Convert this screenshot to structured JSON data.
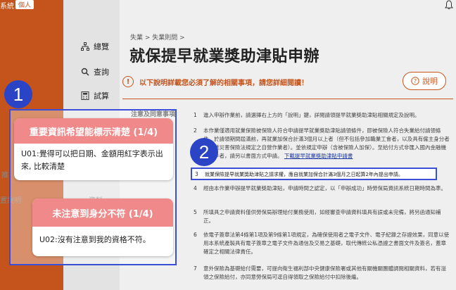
{
  "appbar": {
    "system_label": "系統",
    "tag": "個人"
  },
  "sidebar": {
    "items": [
      {
        "label": "總覽",
        "icon": "sitemap-icon"
      },
      {
        "label": "查詢",
        "icon": "search-icon"
      },
      {
        "label": "試算",
        "icon": "calculator-icon"
      }
    ],
    "faded_label_1": "推",
    "faded_label_2": "置說明",
    "faded_label_3": "資料"
  },
  "main": {
    "breadcrumb": "失業 > 失業則問 >",
    "title": "就保提早就業獎助津貼申辦",
    "notice": "以下說明詳載您必須了解的相關事項，請您詳細閱讀！",
    "explain_button": "說明",
    "left_heading": "注意及同意事項",
    "rules": [
      {
        "num": "1",
        "text": "進入申辦作業前，請選擇右上方的「說明」鍵，詳閱請領提早就業獎助津貼相關規定及說明。"
      },
      {
        "num": "2",
        "text": "本作業僅適用就業保險被保險人符合申請提早就業獎助津貼請領條件，即被保險人符合失業給付請領條件，於請領期間屆滿前，再就業加保合計滿3個月以上者（但不包括參加職業工會者，以及具有僱主身分者及職業災害保險法規定之自營作業者）。並依規定申辦（含被保險人加保）。至給付方式非匯入國內金融機構帳戶者，請另以書面方式申請。",
        "link": "下載提早就業獎助津貼申請書"
      },
      {
        "num": "3",
        "text": "就業保險提早就業獎助津貼之請求權，應自就業加保合計滿3個月之日起算2年內提出申請。"
      },
      {
        "num": "4",
        "text": "經由本作業申辦提早就業獎助津貼，申請時間之認定，以「申辦成功」時勞保局資訊系統日期時間為準。"
      },
      {
        "num": "5",
        "text": "所填具之申請資料僅供勞保局辦理給付業務使用，如經審查申請資料填具有誤或未完備，將另函通知補正。"
      },
      {
        "num": "6",
        "text": "依電子簽章法第4條第1項及第9條第1項規定，為確保使用者之電子文件、電子紀錄之存證效果，同意以使用本系統產製具有電子簽章之電子文件為通信及交易之基礎，取代傳統公私憑證之書面文件及簽名，蓋章確定之相關法律責任。"
      },
      {
        "num": "7",
        "text": "意外保險為基礎給付需要，可提向衛生福利部中央健康保險署或其他有關機關團體調閱相關資料，若有溢領之保險給付，亦同意勞保局可逕自得領取之保險給付中扣除後繼。"
      }
    ]
  },
  "annotations": {
    "badge_1": "1",
    "badge_2": "2",
    "card_1": {
      "title": "重要資訊希望能標示清楚 (1/4)",
      "body": "U01:覺得可以把日期、金額用紅字表示出來, 比較清楚"
    },
    "card_2": {
      "title": "未注意到身分不符 (1/4)",
      "body": "U02:沒有注意到我的資格不符。"
    },
    "colors": {
      "accent": "#c4541c",
      "annotation_blue": "#2b44c6",
      "card_header": "#f08a8a"
    }
  }
}
